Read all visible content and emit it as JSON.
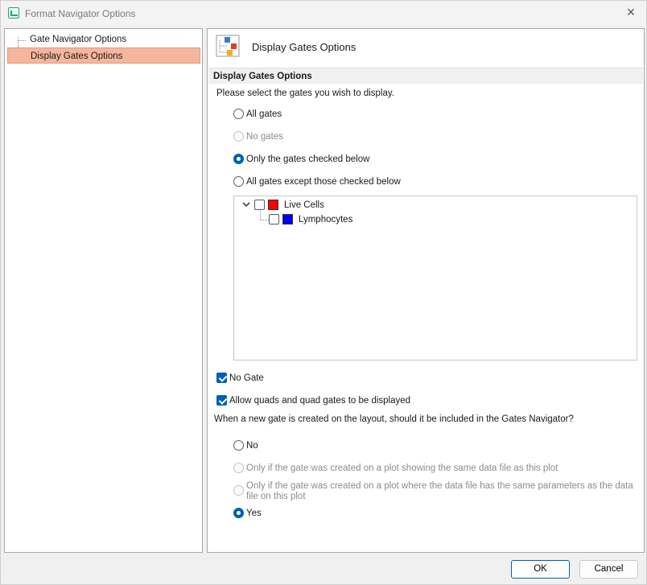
{
  "window": {
    "title": "Format Navigator Options",
    "close_icon": "×"
  },
  "nav": {
    "items": [
      {
        "label": "Gate Navigator Options",
        "selected": false
      },
      {
        "label": "Display Gates Options",
        "selected": true
      }
    ]
  },
  "panel": {
    "header_title": "Display Gates Options",
    "section_title": "Display Gates Options",
    "prompt": "Please select the gates you wish to display.",
    "display_options": [
      {
        "label": "All gates",
        "checked": false,
        "enabled": true
      },
      {
        "label": "No gates",
        "checked": false,
        "enabled": false
      },
      {
        "label": "Only the gates checked below",
        "checked": true,
        "enabled": true
      },
      {
        "label": "All gates except those checked below",
        "checked": false,
        "enabled": true
      }
    ],
    "gates": [
      {
        "label": "Live Cells",
        "color": "#ff0000",
        "checked": false,
        "expanded": true
      },
      {
        "label": "Lymphocytes",
        "color": "#0000ff",
        "checked": false
      }
    ],
    "no_gate": {
      "label": "No Gate",
      "checked": true
    },
    "allow_quads": {
      "label": "Allow quads and quad gates to be displayed",
      "checked": true
    },
    "new_gate_question": "When a new gate is created on the layout, should it be included in the Gates Navigator?",
    "new_gate_options": [
      {
        "label": "No",
        "checked": false,
        "enabled": true
      },
      {
        "label": "Only if the gate was created on a plot showing the same data file as this plot",
        "checked": false,
        "enabled": false
      },
      {
        "label_line1": "Only if the gate was created on a plot where the data file has the same parameters as the data",
        "label_line2": "file on this plot",
        "checked": false,
        "enabled": false
      },
      {
        "label": "Yes",
        "checked": true,
        "enabled": true
      }
    ]
  },
  "footer": {
    "ok_label": "OK",
    "cancel_label": "Cancel"
  },
  "colors": {
    "accent": "#005fb8",
    "selection": "#f6b69e"
  }
}
